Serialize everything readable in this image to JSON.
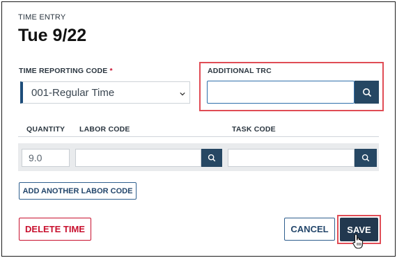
{
  "dialog": {
    "eyebrow": "TIME ENTRY",
    "title": "Tue 9/22"
  },
  "trc": {
    "label": "TIME REPORTING CODE",
    "required_mark": "*",
    "selected": "001-Regular Time"
  },
  "additional_trc": {
    "label": "ADDITIONAL TRC",
    "value": "",
    "placeholder": ""
  },
  "columns": {
    "quantity": "QUANTITY",
    "labor_code": "LABOR CODE",
    "task_code": "TASK CODE"
  },
  "row": {
    "quantity": "9.0",
    "labor_code": "",
    "task_code": ""
  },
  "buttons": {
    "add_labor": "ADD ANOTHER LABOR CODE",
    "delete": "DELETE TIME",
    "cancel": "CANCEL",
    "save": "SAVE"
  },
  "colors": {
    "primary": "#22384f",
    "danger": "#c8102e",
    "highlight": "#e04c55"
  }
}
